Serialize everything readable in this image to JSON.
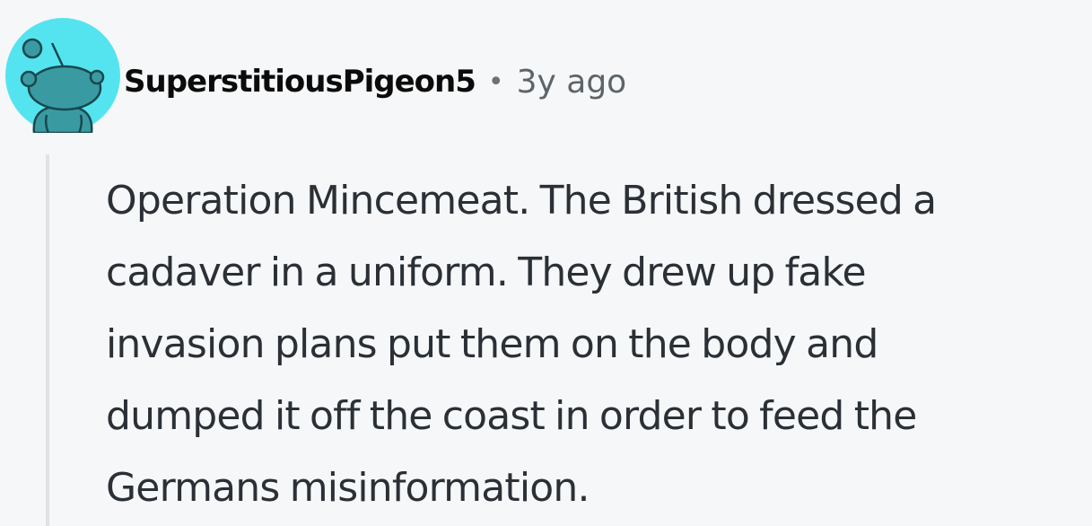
{
  "comment": {
    "author": "SuperstitiousPigeon5",
    "separator": "•",
    "timestamp": "3y ago",
    "avatar_icon": "snoo-avatar-icon",
    "avatar_color": "#54e4f0",
    "body_lines": [
      "Operation Mincemeat. The British dressed a",
      "cadaver in a uniform. They drew up fake",
      "invasion plans put them on the body and",
      "dumped it off the coast in order to feed the",
      "Germans misinformation."
    ]
  }
}
